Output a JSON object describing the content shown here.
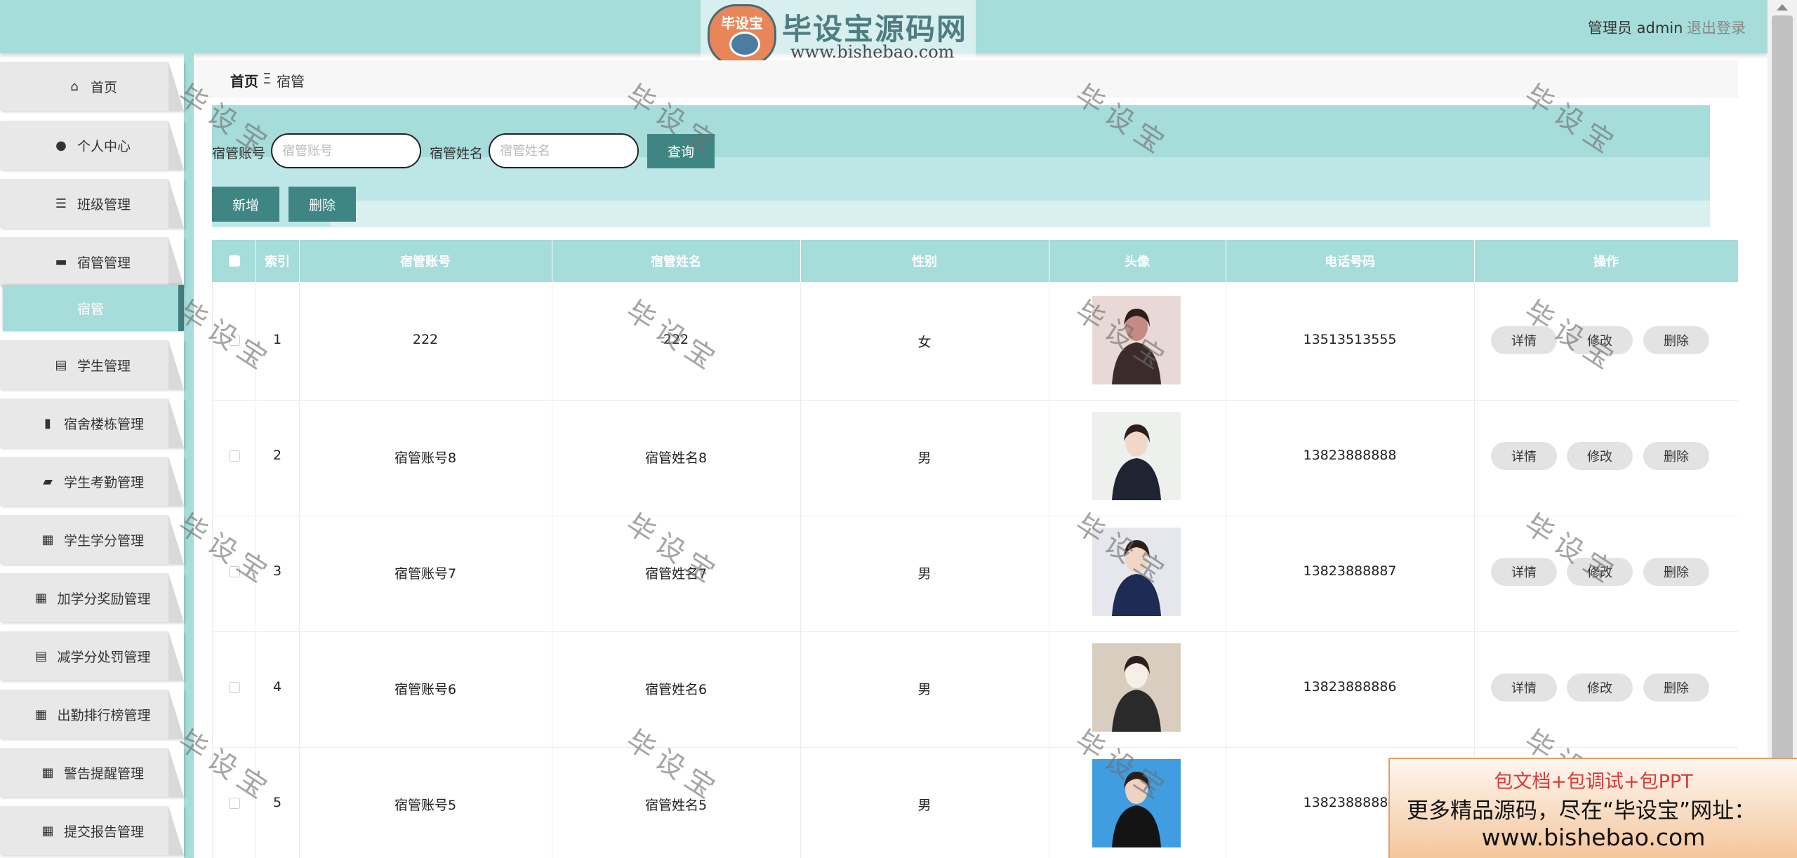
{
  "header": {
    "logo_badge": "毕设宝",
    "logo_title": "毕设宝源码网",
    "logo_url": "www.bishebao.com",
    "user": "管理员 admin",
    "logout": "退出登录"
  },
  "sidebar": {
    "items": [
      {
        "label": "首页",
        "icon": "home-icon"
      },
      {
        "label": "个人中心",
        "icon": "user-icon"
      },
      {
        "label": "班级管理",
        "icon": "sliders-icon"
      },
      {
        "label": "宿管管理",
        "icon": "desktop-icon"
      },
      {
        "label": "学生管理",
        "icon": "clipboard-icon"
      },
      {
        "label": "宿舍楼栋管理",
        "icon": "bar-chart-icon"
      },
      {
        "label": "学生考勤管理",
        "icon": "briefcase-icon"
      },
      {
        "label": "学生学分管理",
        "icon": "grid-icon"
      },
      {
        "label": "加学分奖励管理",
        "icon": "grid-icon"
      },
      {
        "label": "减学分处罚管理",
        "icon": "clipboard-icon"
      },
      {
        "label": "出勤排行榜管理",
        "icon": "grid-icon"
      },
      {
        "label": "警告提醒管理",
        "icon": "grid-icon"
      },
      {
        "label": "提交报告管理",
        "icon": "grid-icon"
      }
    ],
    "submenu_active": "宿管"
  },
  "breadcrumb": {
    "home": "首页",
    "separator": "Ξ",
    "current": "宿管"
  },
  "search": {
    "account_label": "宿管账号",
    "account_placeholder": "宿管账号",
    "name_label": "宿管姓名",
    "name_placeholder": "宿管姓名",
    "query_button": "查询"
  },
  "actions": {
    "add": "新增",
    "delete": "删除"
  },
  "table": {
    "columns": [
      "索引",
      "宿管账号",
      "宿管姓名",
      "性别",
      "头像",
      "电话号码",
      "操作"
    ],
    "rows": [
      {
        "index": "1",
        "account": "222",
        "name": "222",
        "gender": "女",
        "phone": "13513513555"
      },
      {
        "index": "2",
        "account": "宿管账号8",
        "name": "宿管姓名8",
        "gender": "男",
        "phone": "13823888888"
      },
      {
        "index": "3",
        "account": "宿管账号7",
        "name": "宿管姓名7",
        "gender": "男",
        "phone": "13823888887"
      },
      {
        "index": "4",
        "account": "宿管账号6",
        "name": "宿管姓名6",
        "gender": "男",
        "phone": "13823888886"
      },
      {
        "index": "5",
        "account": "宿管账号5",
        "name": "宿管姓名5",
        "gender": "男",
        "phone": "13823888885"
      }
    ],
    "row_buttons": {
      "detail": "详情",
      "edit": "修改",
      "delete": "删除"
    }
  },
  "ad": {
    "line1": "包文档+包调试+包PPT",
    "line2": "更多精品源码，尽在“毕设宝”网址：",
    "line3": "www.bishebao.com"
  },
  "watermark": "毕设宝",
  "colors": {
    "teal": "#a6dcd9",
    "dark_teal": "#3f8583",
    "light_teal": "#bde7e6",
    "menu_gray": "#e8e8e8"
  }
}
